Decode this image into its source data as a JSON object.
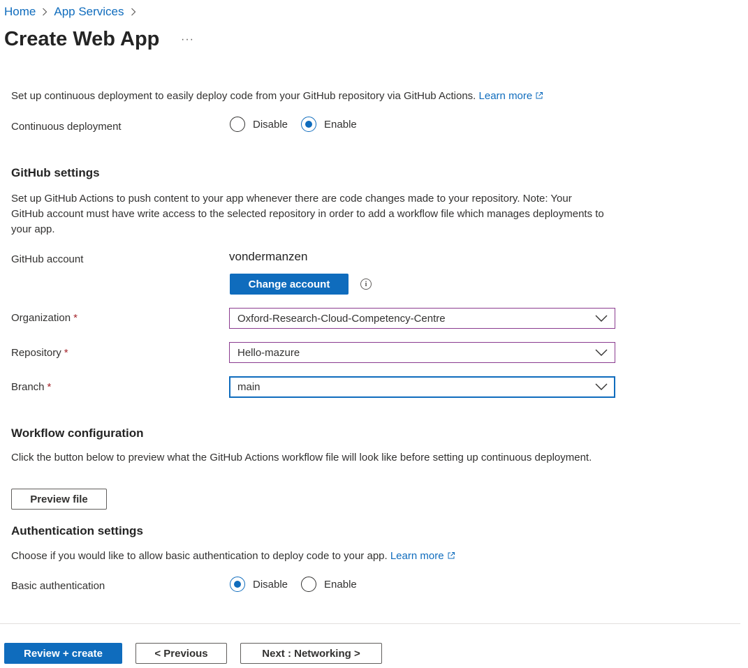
{
  "breadcrumb": {
    "home": "Home",
    "app_services": "App Services"
  },
  "page": {
    "title": "Create Web App",
    "more": "···"
  },
  "deployment": {
    "intro": "Set up continuous deployment to easily deploy code from your GitHub repository via GitHub Actions.",
    "learn_more": "Learn more",
    "label": "Continuous deployment",
    "options": [
      "Disable",
      "Enable"
    ],
    "selected": "Enable"
  },
  "github_settings": {
    "heading": "GitHub settings",
    "description": "Set up GitHub Actions to push content to your app whenever there are code changes made to your repository. Note: Your GitHub account must have write access to the selected repository in order to add a workflow file which manages deployments to your app.",
    "account_label": "GitHub account",
    "account_value": "vondermanzen",
    "change_account": "Change account",
    "info_icon": "info-icon",
    "organization_label": "Organization",
    "organization_value": "Oxford-Research-Cloud-Competency-Centre",
    "repository_label": "Repository",
    "repository_value": "Hello-mazure",
    "branch_label": "Branch",
    "branch_value": "main",
    "required_marker": "*"
  },
  "workflow": {
    "heading": "Workflow configuration",
    "description": "Click the button below to preview what the GitHub Actions workflow file will look like before setting up continuous deployment.",
    "preview_button": "Preview file"
  },
  "authentication": {
    "heading": "Authentication settings",
    "description": "Choose if you would like to allow basic authentication to deploy code to your app.",
    "learn_more": "Learn more",
    "label": "Basic authentication",
    "options": [
      "Disable",
      "Enable"
    ],
    "selected": "Disable"
  },
  "footer": {
    "review_create": "Review + create",
    "previous": "< Previous",
    "next": "Next : Networking >"
  },
  "colors": {
    "accent": "#0f6cbd",
    "required": "#a4262c",
    "field_border": "#8a3b8f"
  }
}
